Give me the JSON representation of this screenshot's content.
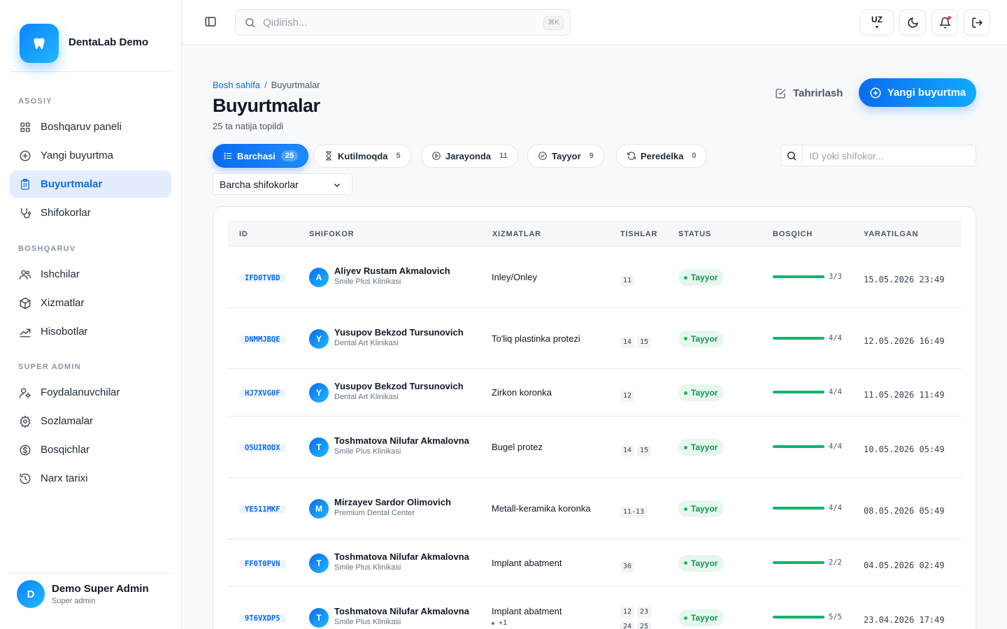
{
  "brand": {
    "name": "DentaLab Demo"
  },
  "sidebar": {
    "sections": [
      {
        "title": "ASOSIY",
        "items": [
          {
            "label": "Boshqaruv paneli",
            "icon": "grid-icon",
            "active": false
          },
          {
            "label": "Yangi buyurtma",
            "icon": "plus-circle-icon",
            "active": false
          },
          {
            "label": "Buyurtmalar",
            "icon": "clipboard-icon",
            "active": true
          },
          {
            "label": "Shifokorlar",
            "icon": "stethoscope-icon",
            "active": false
          }
        ]
      },
      {
        "title": "BOSHQARUV",
        "items": [
          {
            "label": "Ishchilar",
            "icon": "users-icon",
            "active": false
          },
          {
            "label": "Xizmatlar",
            "icon": "package-icon",
            "active": false
          },
          {
            "label": "Hisobotlar",
            "icon": "chart-line-icon",
            "active": false
          }
        ]
      },
      {
        "title": "SUPER ADMIN",
        "items": [
          {
            "label": "Foydalanuvchilar",
            "icon": "user-cog-icon",
            "active": false
          },
          {
            "label": "Sozlamalar",
            "icon": "gear-icon",
            "active": false
          },
          {
            "label": "Bosqichlar",
            "icon": "dollar-circle-icon",
            "active": false
          },
          {
            "label": "Narx tarixi",
            "icon": "history-icon",
            "active": false
          }
        ]
      }
    ],
    "user": {
      "initial": "D",
      "name": "Demo Super Admin",
      "role": "Super admin"
    }
  },
  "topbar": {
    "search_placeholder": "Qidirish...",
    "shortcut": "⌘K",
    "language": "UZ"
  },
  "page": {
    "breadcrumb_home": "Bosh sahifa",
    "breadcrumb_sep": "/",
    "breadcrumb_current": "Buyurtmalar",
    "title": "Buyurtmalar",
    "result_count": "25 ta natija topildi",
    "edit_label": "Tahrirlash",
    "new_order_label": "Yangi buyurtma"
  },
  "filters": {
    "chips": [
      {
        "label": "Barchasi",
        "count": "25",
        "icon": "list-icon",
        "active": true
      },
      {
        "label": "Kutilmoqda",
        "count": "5",
        "icon": "hourglass-icon",
        "active": false
      },
      {
        "label": "Jarayonda",
        "count": "11",
        "icon": "play-circle-icon",
        "active": false
      },
      {
        "label": "Tayyor",
        "count": "9",
        "icon": "check-circle-icon",
        "active": false
      },
      {
        "label": "Peredelka",
        "count": "0",
        "icon": "refresh-icon",
        "active": false
      }
    ],
    "search_placeholder": "ID yoki shifokor...",
    "doctor_select": "Barcha shifokorlar"
  },
  "table": {
    "headers": [
      "ID",
      "SHIFOKOR",
      "XIZMATLAR",
      "TISHLAR",
      "STATUS",
      "BOSQICH",
      "YARATILGAN"
    ],
    "rows": [
      {
        "id": "IFD0TVBD",
        "initial": "A",
        "doctor": "Aliyev Rustam Akmalovich",
        "clinic": "Smile Plus Klinikasi",
        "service": "Inley/Onley",
        "extra": "",
        "teeth": [
          "11"
        ],
        "status": "Tayyor",
        "stage_done": 3,
        "stage_total": 3,
        "stage_text": "3/3",
        "created": "15.05.2026 23:49"
      },
      {
        "id": "DNMMJBQE",
        "initial": "Y",
        "doctor": "Yusupov Bekzod Tursunovich",
        "clinic": "Dental Art Klinikasi",
        "service": "To'liq plastinka protezi",
        "extra": "",
        "teeth": [
          "14",
          "15"
        ],
        "status": "Tayyor",
        "stage_done": 4,
        "stage_total": 4,
        "stage_text": "4/4",
        "created": "12.05.2026 16:49"
      },
      {
        "id": "HJ7XVG0F",
        "initial": "Y",
        "doctor": "Yusupov Bekzod Tursunovich",
        "clinic": "Dental Art Klinikasi",
        "service": "Zirkon koronka",
        "extra": "",
        "teeth": [
          "12"
        ],
        "status": "Tayyor",
        "stage_done": 4,
        "stage_total": 4,
        "stage_text": "4/4",
        "created": "11.05.2026 11:49"
      },
      {
        "id": "O5UIRODX",
        "initial": "T",
        "doctor": "Toshmatova Nilufar Akmalovna",
        "clinic": "Smile Plus Klinikasi",
        "service": "Bugel protez",
        "extra": "",
        "teeth": [
          "14",
          "15"
        ],
        "status": "Tayyor",
        "stage_done": 4,
        "stage_total": 4,
        "stage_text": "4/4",
        "created": "10.05.2026 05:49"
      },
      {
        "id": "YE511MKF",
        "initial": "M",
        "doctor": "Mirzayev Sardor Olimovich",
        "clinic": "Premium Dental Center",
        "service": "Metall-keramika koronka",
        "extra": "",
        "teeth": [
          "11-13"
        ],
        "status": "Tayyor",
        "stage_done": 4,
        "stage_total": 4,
        "stage_text": "4/4",
        "created": "08.05.2026 05:49"
      },
      {
        "id": "FF0T0PVN",
        "initial": "T",
        "doctor": "Toshmatova Nilufar Akmalovna",
        "clinic": "Smile Plus Klinikasi",
        "service": "Implant abatment",
        "extra": "",
        "teeth": [
          "36"
        ],
        "status": "Tayyor",
        "stage_done": 2,
        "stage_total": 2,
        "stage_text": "2/2",
        "created": "04.05.2026 02:49"
      },
      {
        "id": "9T6VXDP5",
        "initial": "T",
        "doctor": "Toshmatova Nilufar Akmalovna",
        "clinic": "Smile Plus Klinikasi",
        "service": "Implant abatment",
        "extra": "+1",
        "teeth": [
          "12",
          "23",
          "24",
          "25"
        ],
        "status": "Tayyor",
        "stage_done": 5,
        "stage_total": 5,
        "stage_text": "5/5",
        "created": "23.04.2026 17:49"
      }
    ]
  },
  "colors": {
    "accent": "#0a6cf0",
    "success": "#15964e",
    "sidebar_active_bg": "#e3edff"
  }
}
